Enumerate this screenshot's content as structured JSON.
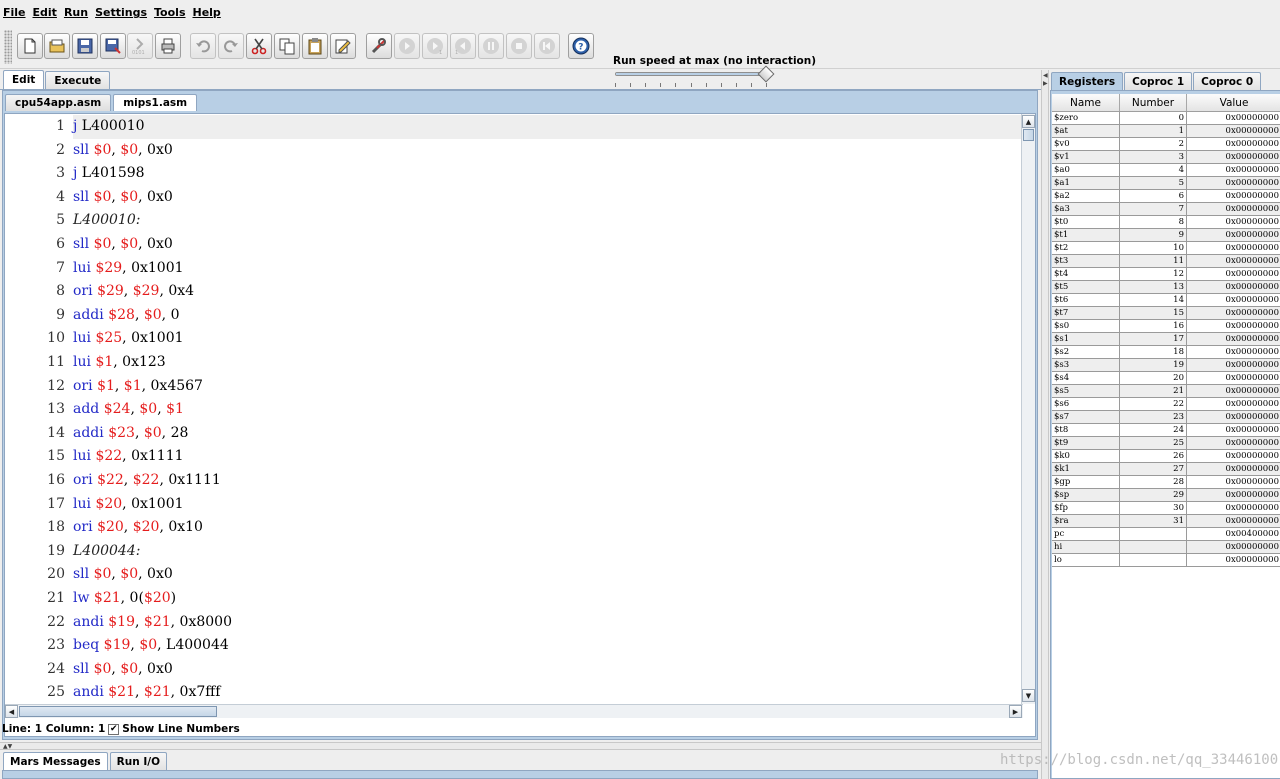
{
  "menu": [
    "File",
    "Edit",
    "Run",
    "Settings",
    "Tools",
    "Help"
  ],
  "toolbar": {
    "buttons": [
      {
        "name": "new-file-button",
        "icon": "new-file-icon",
        "enabled": true
      },
      {
        "name": "open-button",
        "icon": "folder-open-icon",
        "enabled": true
      },
      {
        "name": "save-button",
        "icon": "save-icon",
        "enabled": true
      },
      {
        "name": "save-as-button",
        "icon": "save-as-icon",
        "enabled": true
      },
      {
        "name": "dump-memory-button",
        "icon": "dump-memory-icon",
        "enabled": false
      },
      {
        "name": "print-button",
        "icon": "printer-icon",
        "enabled": true
      },
      {
        "name": "undo-button",
        "icon": "undo-icon",
        "enabled": false
      },
      {
        "name": "redo-button",
        "icon": "redo-icon",
        "enabled": false
      },
      {
        "name": "cut-button",
        "icon": "scissors-icon",
        "enabled": true
      },
      {
        "name": "copy-button",
        "icon": "copy-icon",
        "enabled": true
      },
      {
        "name": "paste-button",
        "icon": "paste-icon",
        "enabled": true
      },
      {
        "name": "find-replace-button",
        "icon": "find-replace-icon",
        "enabled": true
      },
      {
        "name": "assemble-button",
        "icon": "wrench-screwdriver-icon",
        "enabled": true
      },
      {
        "name": "run-button",
        "icon": "run-icon",
        "enabled": false
      },
      {
        "name": "step-button",
        "icon": "step-icon",
        "enabled": false
      },
      {
        "name": "backstep-button",
        "icon": "backstep-icon",
        "enabled": false
      },
      {
        "name": "pause-button",
        "icon": "pause-icon",
        "enabled": false
      },
      {
        "name": "stop-button",
        "icon": "stop-icon",
        "enabled": false
      },
      {
        "name": "reset-button",
        "icon": "reset-icon",
        "enabled": false
      },
      {
        "name": "help-button",
        "icon": "help-icon",
        "enabled": true
      }
    ],
    "speed_label": "Run speed at max (no interaction)",
    "speed_fraction": 1.0
  },
  "main_tabs": [
    "Edit",
    "Execute"
  ],
  "file_tabs": [
    "cpu54app.asm",
    "mips1.asm"
  ],
  "active_file_tab": 1,
  "colors": {
    "opcode": "#2229c7",
    "register": "#e51d1d",
    "label": "#222222",
    "tab_blue": "#b8cfe5"
  },
  "code_lines": [
    [
      [
        "op",
        "j"
      ],
      [
        "arg",
        " L400010"
      ]
    ],
    [
      [
        "op",
        "sll"
      ],
      [
        "arg",
        " "
      ],
      [
        "reg",
        "$0"
      ],
      [
        "arg",
        ", "
      ],
      [
        "reg",
        "$0"
      ],
      [
        "arg",
        ", 0x0"
      ]
    ],
    [
      [
        "op",
        "j"
      ],
      [
        "arg",
        " L401598"
      ]
    ],
    [
      [
        "op",
        "sll"
      ],
      [
        "arg",
        " "
      ],
      [
        "reg",
        "$0"
      ],
      [
        "arg",
        ", "
      ],
      [
        "reg",
        "$0"
      ],
      [
        "arg",
        ", 0x0"
      ]
    ],
    [
      [
        "lbl",
        "L400010:"
      ]
    ],
    [
      [
        "op",
        "sll"
      ],
      [
        "arg",
        " "
      ],
      [
        "reg",
        "$0"
      ],
      [
        "arg",
        ", "
      ],
      [
        "reg",
        "$0"
      ],
      [
        "arg",
        ", 0x0"
      ]
    ],
    [
      [
        "op",
        "lui"
      ],
      [
        "arg",
        " "
      ],
      [
        "reg",
        "$29"
      ],
      [
        "arg",
        ", 0x1001"
      ]
    ],
    [
      [
        "op",
        "ori"
      ],
      [
        "arg",
        " "
      ],
      [
        "reg",
        "$29"
      ],
      [
        "arg",
        ", "
      ],
      [
        "reg",
        "$29"
      ],
      [
        "arg",
        ", 0x4"
      ]
    ],
    [
      [
        "op",
        "addi"
      ],
      [
        "arg",
        " "
      ],
      [
        "reg",
        "$28"
      ],
      [
        "arg",
        ", "
      ],
      [
        "reg",
        "$0"
      ],
      [
        "arg",
        ", 0"
      ]
    ],
    [
      [
        "op",
        "lui"
      ],
      [
        "arg",
        " "
      ],
      [
        "reg",
        "$25"
      ],
      [
        "arg",
        ", 0x1001"
      ]
    ],
    [
      [
        "op",
        "lui"
      ],
      [
        "arg",
        " "
      ],
      [
        "reg",
        "$1"
      ],
      [
        "arg",
        ", 0x123"
      ]
    ],
    [
      [
        "op",
        "ori"
      ],
      [
        "arg",
        " "
      ],
      [
        "reg",
        "$1"
      ],
      [
        "arg",
        ", "
      ],
      [
        "reg",
        "$1"
      ],
      [
        "arg",
        ", 0x4567"
      ]
    ],
    [
      [
        "op",
        "add"
      ],
      [
        "arg",
        " "
      ],
      [
        "reg",
        "$24"
      ],
      [
        "arg",
        ", "
      ],
      [
        "reg",
        "$0"
      ],
      [
        "arg",
        ", "
      ],
      [
        "reg",
        "$1"
      ]
    ],
    [
      [
        "op",
        "addi"
      ],
      [
        "arg",
        " "
      ],
      [
        "reg",
        "$23"
      ],
      [
        "arg",
        ", "
      ],
      [
        "reg",
        "$0"
      ],
      [
        "arg",
        ", 28"
      ]
    ],
    [
      [
        "op",
        "lui"
      ],
      [
        "arg",
        " "
      ],
      [
        "reg",
        "$22"
      ],
      [
        "arg",
        ", 0x1111"
      ]
    ],
    [
      [
        "op",
        "ori"
      ],
      [
        "arg",
        " "
      ],
      [
        "reg",
        "$22"
      ],
      [
        "arg",
        ", "
      ],
      [
        "reg",
        "$22"
      ],
      [
        "arg",
        ", 0x1111"
      ]
    ],
    [
      [
        "op",
        "lui"
      ],
      [
        "arg",
        " "
      ],
      [
        "reg",
        "$20"
      ],
      [
        "arg",
        ", 0x1001"
      ]
    ],
    [
      [
        "op",
        "ori"
      ],
      [
        "arg",
        " "
      ],
      [
        "reg",
        "$20"
      ],
      [
        "arg",
        ", "
      ],
      [
        "reg",
        "$20"
      ],
      [
        "arg",
        ", 0x10"
      ]
    ],
    [
      [
        "lbl",
        "L400044:"
      ]
    ],
    [
      [
        "op",
        "sll"
      ],
      [
        "arg",
        " "
      ],
      [
        "reg",
        "$0"
      ],
      [
        "arg",
        ", "
      ],
      [
        "reg",
        "$0"
      ],
      [
        "arg",
        ", 0x0"
      ]
    ],
    [
      [
        "op",
        "lw"
      ],
      [
        "arg",
        " "
      ],
      [
        "reg",
        "$21"
      ],
      [
        "arg",
        ", 0("
      ],
      [
        "reg",
        "$20"
      ],
      [
        "arg",
        ")"
      ]
    ],
    [
      [
        "op",
        "andi"
      ],
      [
        "arg",
        " "
      ],
      [
        "reg",
        "$19"
      ],
      [
        "arg",
        ", "
      ],
      [
        "reg",
        "$21"
      ],
      [
        "arg",
        ", 0x8000"
      ]
    ],
    [
      [
        "op",
        "beq"
      ],
      [
        "arg",
        " "
      ],
      [
        "reg",
        "$19"
      ],
      [
        "arg",
        ", "
      ],
      [
        "reg",
        "$0"
      ],
      [
        "arg",
        ", L400044"
      ]
    ],
    [
      [
        "op",
        "sll"
      ],
      [
        "arg",
        " "
      ],
      [
        "reg",
        "$0"
      ],
      [
        "arg",
        ", "
      ],
      [
        "reg",
        "$0"
      ],
      [
        "arg",
        ", 0x0"
      ]
    ],
    [
      [
        "op",
        "andi"
      ],
      [
        "arg",
        " "
      ],
      [
        "reg",
        "$21"
      ],
      [
        "arg",
        ", "
      ],
      [
        "reg",
        "$21"
      ],
      [
        "arg",
        ", 0x7fff"
      ]
    ]
  ],
  "line_numbers": [
    "1",
    "2",
    "3",
    "4",
    "5",
    "6",
    "7",
    "8",
    "9",
    "10",
    "11",
    "12",
    "13",
    "14",
    "15",
    "16",
    "17",
    "18",
    "19",
    "20",
    "21",
    "22",
    "23",
    "24",
    "25"
  ],
  "status": {
    "position": "Line: 1 Column: 1",
    "show_line_numbers_label": "Show Line Numbers",
    "show_line_numbers_checked": true
  },
  "bottom_tabs": [
    "Mars Messages",
    "Run I/O"
  ],
  "registers": {
    "tabs": [
      "Registers",
      "Coproc 1",
      "Coproc 0"
    ],
    "columns": [
      "Name",
      "Number",
      "Value"
    ],
    "rows": [
      [
        "$zero",
        "0",
        "0x00000000"
      ],
      [
        "$at",
        "1",
        "0x00000000"
      ],
      [
        "$v0",
        "2",
        "0x00000000"
      ],
      [
        "$v1",
        "3",
        "0x00000000"
      ],
      [
        "$a0",
        "4",
        "0x00000000"
      ],
      [
        "$a1",
        "5",
        "0x00000000"
      ],
      [
        "$a2",
        "6",
        "0x00000000"
      ],
      [
        "$a3",
        "7",
        "0x00000000"
      ],
      [
        "$t0",
        "8",
        "0x00000000"
      ],
      [
        "$t1",
        "9",
        "0x00000000"
      ],
      [
        "$t2",
        "10",
        "0x00000000"
      ],
      [
        "$t3",
        "11",
        "0x00000000"
      ],
      [
        "$t4",
        "12",
        "0x00000000"
      ],
      [
        "$t5",
        "13",
        "0x00000000"
      ],
      [
        "$t6",
        "14",
        "0x00000000"
      ],
      [
        "$t7",
        "15",
        "0x00000000"
      ],
      [
        "$s0",
        "16",
        "0x00000000"
      ],
      [
        "$s1",
        "17",
        "0x00000000"
      ],
      [
        "$s2",
        "18",
        "0x00000000"
      ],
      [
        "$s3",
        "19",
        "0x00000000"
      ],
      [
        "$s4",
        "20",
        "0x00000000"
      ],
      [
        "$s5",
        "21",
        "0x00000000"
      ],
      [
        "$s6",
        "22",
        "0x00000000"
      ],
      [
        "$s7",
        "23",
        "0x00000000"
      ],
      [
        "$t8",
        "24",
        "0x00000000"
      ],
      [
        "$t9",
        "25",
        "0x00000000"
      ],
      [
        "$k0",
        "26",
        "0x00000000"
      ],
      [
        "$k1",
        "27",
        "0x00000000"
      ],
      [
        "$gp",
        "28",
        "0x00000000"
      ],
      [
        "$sp",
        "29",
        "0x00000000"
      ],
      [
        "$fp",
        "30",
        "0x00000000"
      ],
      [
        "$ra",
        "31",
        "0x00000000"
      ],
      [
        "pc",
        "",
        "0x00400000"
      ],
      [
        "hi",
        "",
        "0x00000000"
      ],
      [
        "lo",
        "",
        "0x00000000"
      ]
    ]
  },
  "watermark": "https://blog.csdn.net/qq_33446100"
}
